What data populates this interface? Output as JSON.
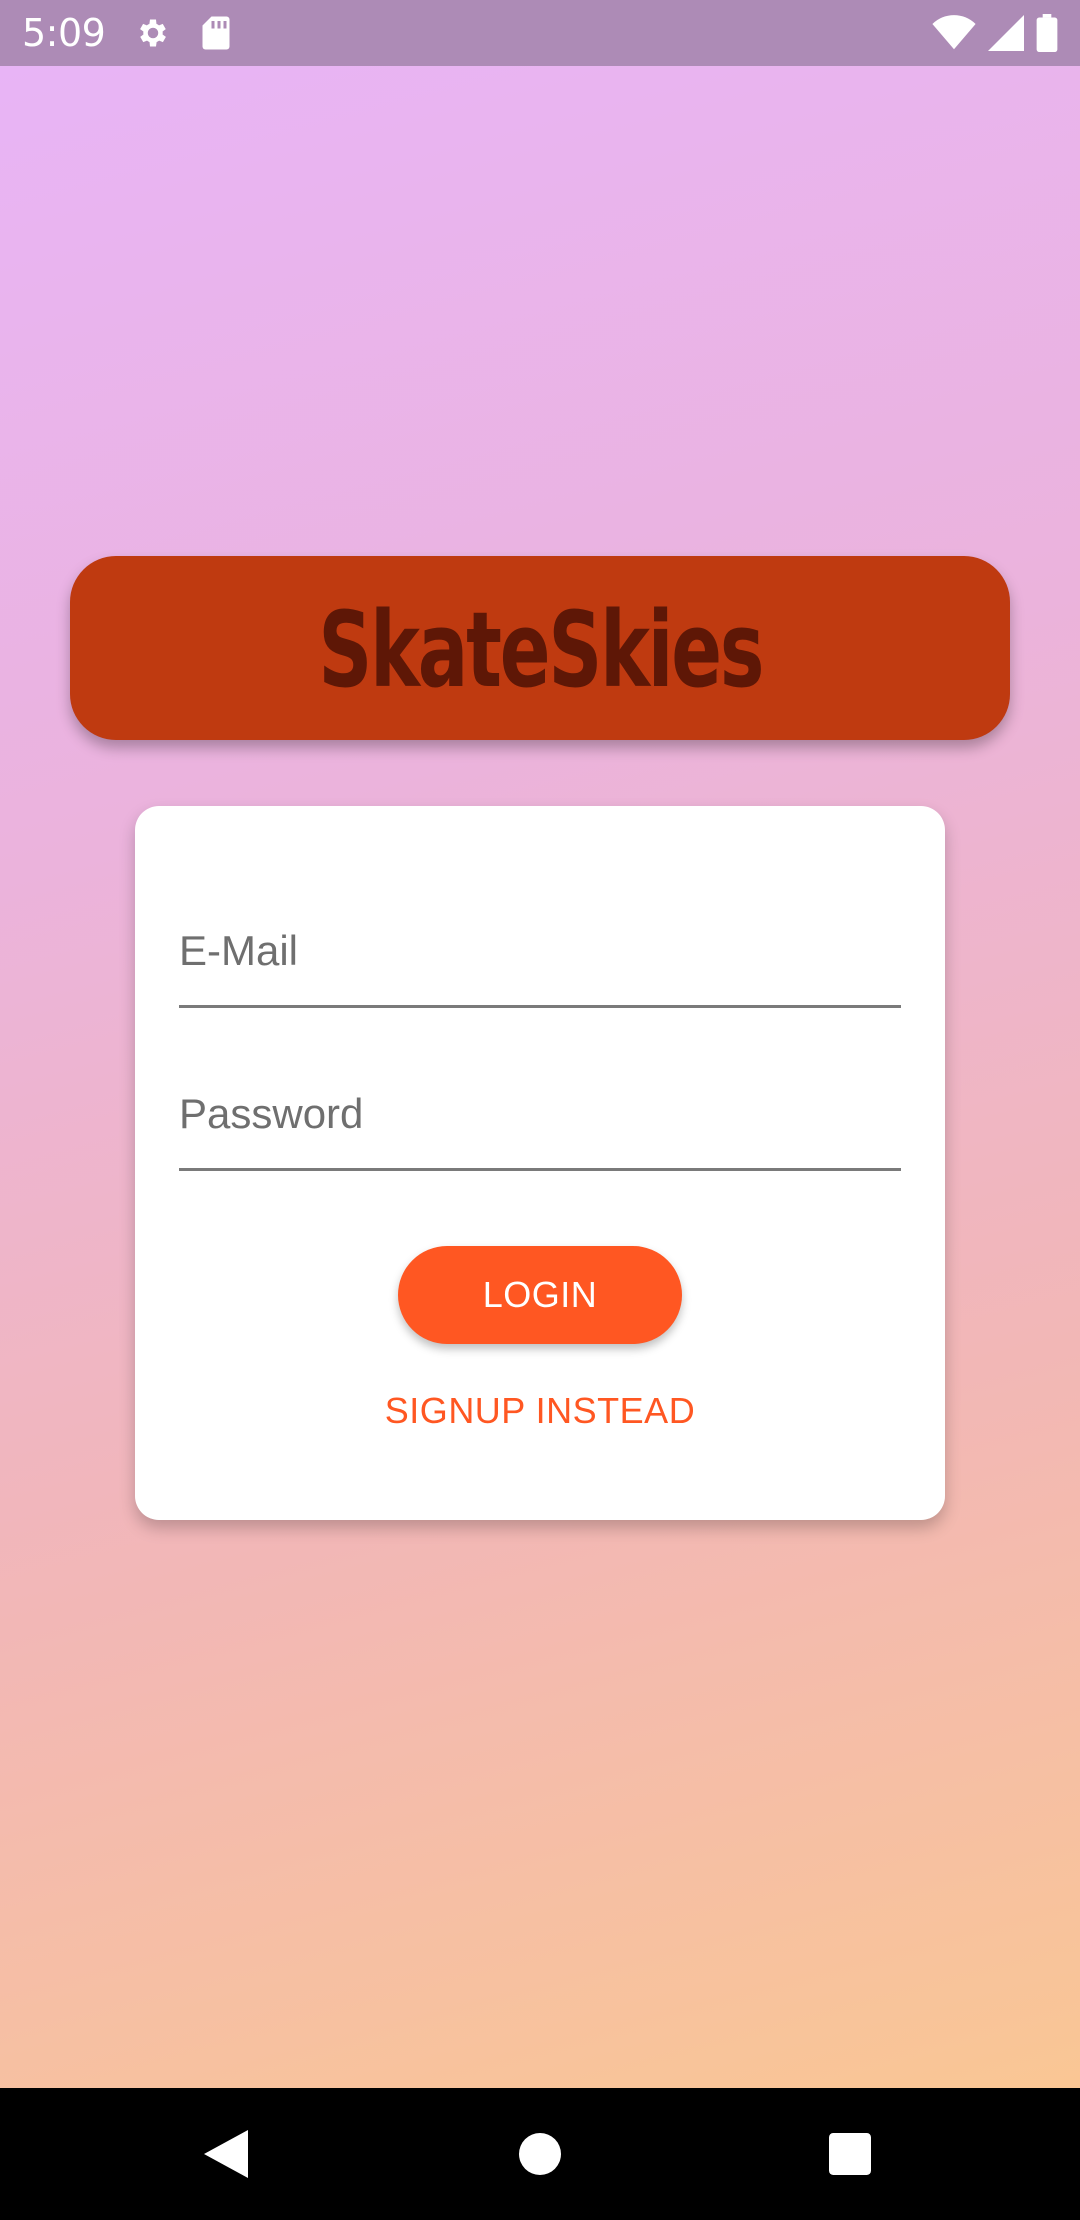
{
  "status_bar": {
    "time": "5:09",
    "icons": [
      "settings-icon",
      "sd-card-icon",
      "wifi-icon",
      "cellular-signal-icon",
      "battery-icon"
    ]
  },
  "brand": {
    "name": "SkateSkies",
    "banner_color": "#bf3a10",
    "text_color": "#5e1706"
  },
  "login_form": {
    "email_placeholder": "E-Mail",
    "email_value": "",
    "password_placeholder": "Password",
    "password_value": "",
    "login_label": "LOGIN",
    "signup_label": "SIGNUP INSTEAD",
    "accent_color": "#ff5722"
  },
  "nav_bar": {
    "icons": [
      "back-icon",
      "home-icon",
      "recents-icon"
    ]
  }
}
